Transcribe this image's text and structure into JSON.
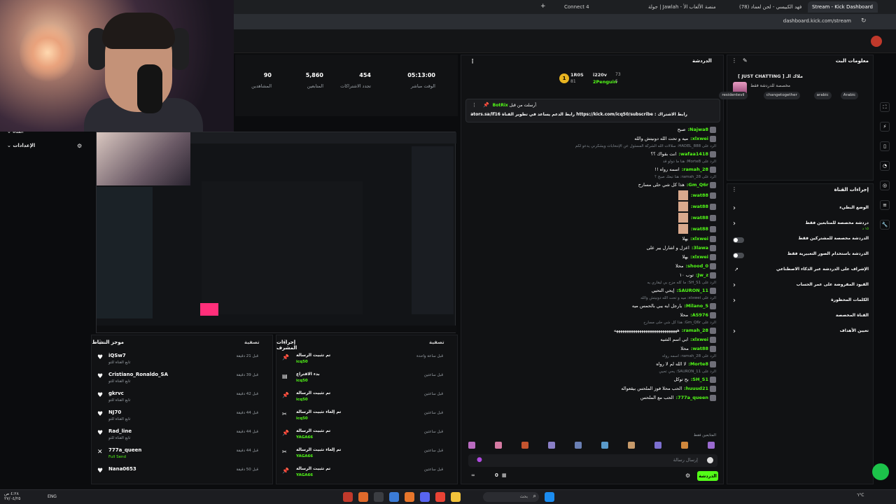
{
  "browser": {
    "tabs": [
      "Connect 4",
      "جولة | Jawlah - منصة الألعاب الأ",
      "(78) فهد الكبيسي - لحن لعماد",
      "Stream - Kick Dashboard"
    ],
    "url": "dashboard.kick.com/stream"
  },
  "stats": [
    {
      "value": "05:13:00",
      "label": "الوقت مباشر"
    },
    {
      "value": "454",
      "label": "تجدد الاشتراكات"
    },
    {
      "value": "5,860",
      "label": "المتابعين"
    },
    {
      "value": "90",
      "label": "المشاهدين"
    }
  ],
  "left_nav": [
    {
      "label": "القناة"
    },
    {
      "label": "الإعدادات"
    }
  ],
  "chat": {
    "title": "الدردشة",
    "leaderboard": [
      {
        "rank": "1",
        "name": "1R0S",
        "score": "81"
      },
      {
        "rank": "",
        "name": "i220v",
        "score": "73"
      },
      {
        "rank": "",
        "name": "2Penguin",
        "score": "5"
      }
    ],
    "pinned_by": "أرسلت من قبل",
    "pinned_user": "BotRix",
    "pinned_text": "رابط الاشتراك : https://kick.com/icq50/subscribe رابط الدعم يساعد في تطوير القناة https://creators.sa/lf16",
    "messages": [
      {
        "reply": "",
        "user": "Najwa8:",
        "text": "صبح"
      },
      {
        "reply": "",
        "user": "xlxwei:",
        "text": "ميه و تحت الله دونيتش والله"
      },
      {
        "reply": "الرد على HADEL_888: سلالات الله الشركة المسئول عن الإنتخابات ويشكرني يدعو لكم",
        "user": "wafaa1418:",
        "text": "انت بقواك ؟؟"
      },
      {
        "reply": "الرد على Morte8: هنا ما دولو قد",
        "user": "ramah_28:",
        "text": "اسمه رواه !!"
      },
      {
        "reply": "الرد على ramah_28: هنا تبعك صبح ؟",
        "user": "Gm_Q6r:",
        "text": "هذا كل شي حلى مسارح"
      },
      {
        "reply": "",
        "user": "wat88:",
        "text": ""
      },
      {
        "reply": "",
        "user": "wat88:",
        "text": ""
      },
      {
        "reply": "",
        "user": "wat88:",
        "text": ""
      },
      {
        "reply": "",
        "user": "wat88:",
        "text": ""
      },
      {
        "reply": "",
        "user": "xlxwei:",
        "text": "يهلا"
      },
      {
        "reply": "",
        "user": "3lawa:",
        "text": "اعزل و اشارل يير على"
      },
      {
        "reply": "",
        "user": "xlxwei:",
        "text": "يهلا"
      },
      {
        "reply": "",
        "user": "shood_0:",
        "text": "محلا"
      },
      {
        "reply": "",
        "user": "Jw_z:",
        "text": "توب ١٠"
      },
      {
        "reply": "الرد على SH_S1: ما كله مزح بي ليقاري يه",
        "user": "SAURON_11:",
        "text": "إيحي التحيي"
      },
      {
        "reply": "الرد على xlxwei: ميه و تحت الله دونيتش والله",
        "user": "Milano_5:",
        "text": "يارجل ايه يبي بالحمس ميه"
      },
      {
        "reply": "",
        "user": "AS976:",
        "text": "محلا"
      },
      {
        "reply": "الرد على Gm_Q6r: هذا كل شي حلى مسارح",
        "user": "ramah_28:",
        "text": "ههههههههههههههههههههههههههههههه"
      },
      {
        "reply": "",
        "user": "xlxwei:",
        "text": "ابي اسم الشيه"
      },
      {
        "reply": "",
        "user": "wat88:",
        "text": "محلا"
      },
      {
        "reply": "الرد على ramah_28: اسمه رواه",
        "user": "Morte8:",
        "text": "لا الله لم لا رواه"
      },
      {
        "reply": "الرد على SAURON_11: يحي تحيي",
        "user": "SH_S1:",
        "text": "بح توكل"
      },
      {
        "reply": "",
        "user": "huuud21:",
        "text": "الحب محلا فوز الملحس بيقعواله"
      },
      {
        "reply": "",
        "user": "777a_queen:",
        "text": "الحب مع الملحس"
      }
    ],
    "emote_label": "المتابعين فقط",
    "input_placeholder": "إرسال رسالة",
    "send_label": "الدردشة",
    "bottom_count": "0"
  },
  "stream_info": {
    "title": "معلومات البث",
    "stream_title": "ملاك الـ [ JUST CHATTING ]",
    "category": "مخصصة للدردشة فقط",
    "tags": [
      "Arabic",
      "arabic",
      "changetogether",
      "residentevil"
    ]
  },
  "channel_actions": {
    "title": "إجراءات القناة",
    "items": [
      {
        "label": "الوضع البطيء",
        "control": "chevron",
        "sub": ""
      },
      {
        "label": "دردشة مخصصة للمتابعين فقط",
        "control": "chevron",
        "sub": "١٥ د"
      },
      {
        "label": "الدردشة مخصصة للمشتركين فقط",
        "control": "toggle",
        "sub": ""
      },
      {
        "label": "الدردشة باستخدام الصور التعبيرية فقط",
        "control": "toggle",
        "sub": ""
      },
      {
        "label": "الإشراف على الدردشة عبر الذكاء الاصطناعي",
        "control": "external",
        "sub": ""
      },
      {
        "label": "القيود المفروضة على عمر الحساب",
        "control": "chevron",
        "sub": ""
      },
      {
        "label": "الكلمات المحظورة",
        "control": "chevron",
        "sub": ""
      },
      {
        "label": "القناة المخصصة",
        "control": "none",
        "sub": ""
      },
      {
        "label": "تعيين الأهداف",
        "control": "chevron",
        "sub": ""
      }
    ]
  },
  "activity": {
    "title": "موجز النشاط",
    "filter": "تصفية",
    "items": [
      {
        "name": "iQSw7",
        "sub": "تابع القناة للتو",
        "time": "قبل 21 دقيقة",
        "icon": "heart-icon"
      },
      {
        "name": "Cristiano_Ronaldo_SA",
        "sub": "تابع القناة للتو",
        "time": "قبل 39 دقيقة",
        "icon": "heart-icon"
      },
      {
        "name": "gkrvc",
        "sub": "تابع القناة للتو",
        "time": "قبل 42 دقيقة",
        "icon": "heart-icon"
      },
      {
        "name": "NJ70",
        "sub": "تابع القناة للتو",
        "time": "قبل 44 دقيقة",
        "icon": "heart-icon"
      },
      {
        "name": "Rad_line",
        "sub": "تابع القناة للتو",
        "time": "قبل 44 دقيقة",
        "icon": "heart-icon"
      },
      {
        "name": "777a_queen",
        "sub": "Full Send",
        "time": "قبل 44 دقيقة",
        "icon": "kick-icon"
      },
      {
        "name": "Nana0653",
        "sub": "",
        "time": "قبل 50 دقيقة",
        "icon": "heart-icon"
      }
    ]
  },
  "mod_actions": {
    "title": "إجراءات المشرف",
    "filter": "تصفية",
    "items": [
      {
        "name": "تم تثبيت الرسالة",
        "sub": "icq50",
        "time": "قبل ساعة واحدة",
        "icon": "pin-icon"
      },
      {
        "name": "بدء الاقتراع",
        "sub": "icq50",
        "time": "قبل ساعتين",
        "icon": "poll-icon"
      },
      {
        "name": "تم تثبيت الرسالة",
        "sub": "icq50",
        "time": "قبل ساعتين",
        "icon": "pin-icon"
      },
      {
        "name": "تم إلغاء تثبيت الرسالة",
        "sub": "icq50",
        "time": "قبل ساعتين",
        "icon": "unpin-icon"
      },
      {
        "name": "تم تثبيت الرسالة",
        "sub": "YAGA66",
        "time": "قبل ساعتين",
        "icon": "pin-icon"
      },
      {
        "name": "تم إلغاء تثبيت الرسالة",
        "sub": "YAGA66",
        "time": "قبل ساعتين",
        "icon": "unpin-icon"
      },
      {
        "name": "تم تثبيت الرسالة",
        "sub": "YAGA66",
        "time": "قبل ساعتين",
        "icon": "pin-icon"
      }
    ]
  },
  "taskbar": {
    "lang": "ENG",
    "time": "٤:٢٨ ص",
    "date": "٢٧/٠٤/٢٥",
    "weather": "٦°C",
    "search_placeholder": "بحث"
  }
}
